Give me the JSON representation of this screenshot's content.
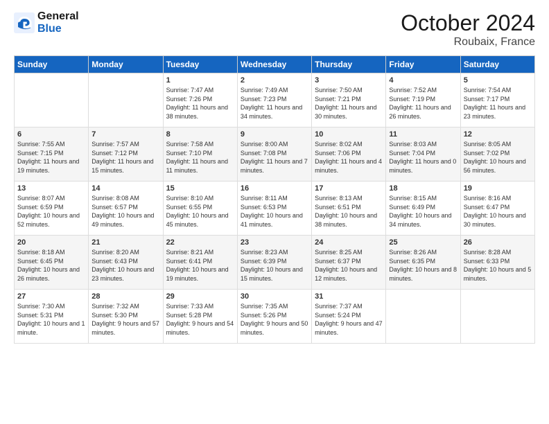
{
  "header": {
    "logo_line1": "General",
    "logo_line2": "Blue",
    "month": "October 2024",
    "location": "Roubaix, France"
  },
  "days_of_week": [
    "Sunday",
    "Monday",
    "Tuesday",
    "Wednesday",
    "Thursday",
    "Friday",
    "Saturday"
  ],
  "weeks": [
    [
      {
        "day": "",
        "info": ""
      },
      {
        "day": "",
        "info": ""
      },
      {
        "day": "1",
        "info": "Sunrise: 7:47 AM\nSunset: 7:26 PM\nDaylight: 11 hours and 38 minutes."
      },
      {
        "day": "2",
        "info": "Sunrise: 7:49 AM\nSunset: 7:23 PM\nDaylight: 11 hours and 34 minutes."
      },
      {
        "day": "3",
        "info": "Sunrise: 7:50 AM\nSunset: 7:21 PM\nDaylight: 11 hours and 30 minutes."
      },
      {
        "day": "4",
        "info": "Sunrise: 7:52 AM\nSunset: 7:19 PM\nDaylight: 11 hours and 26 minutes."
      },
      {
        "day": "5",
        "info": "Sunrise: 7:54 AM\nSunset: 7:17 PM\nDaylight: 11 hours and 23 minutes."
      }
    ],
    [
      {
        "day": "6",
        "info": "Sunrise: 7:55 AM\nSunset: 7:15 PM\nDaylight: 11 hours and 19 minutes."
      },
      {
        "day": "7",
        "info": "Sunrise: 7:57 AM\nSunset: 7:12 PM\nDaylight: 11 hours and 15 minutes."
      },
      {
        "day": "8",
        "info": "Sunrise: 7:58 AM\nSunset: 7:10 PM\nDaylight: 11 hours and 11 minutes."
      },
      {
        "day": "9",
        "info": "Sunrise: 8:00 AM\nSunset: 7:08 PM\nDaylight: 11 hours and 7 minutes."
      },
      {
        "day": "10",
        "info": "Sunrise: 8:02 AM\nSunset: 7:06 PM\nDaylight: 11 hours and 4 minutes."
      },
      {
        "day": "11",
        "info": "Sunrise: 8:03 AM\nSunset: 7:04 PM\nDaylight: 11 hours and 0 minutes."
      },
      {
        "day": "12",
        "info": "Sunrise: 8:05 AM\nSunset: 7:02 PM\nDaylight: 10 hours and 56 minutes."
      }
    ],
    [
      {
        "day": "13",
        "info": "Sunrise: 8:07 AM\nSunset: 6:59 PM\nDaylight: 10 hours and 52 minutes."
      },
      {
        "day": "14",
        "info": "Sunrise: 8:08 AM\nSunset: 6:57 PM\nDaylight: 10 hours and 49 minutes."
      },
      {
        "day": "15",
        "info": "Sunrise: 8:10 AM\nSunset: 6:55 PM\nDaylight: 10 hours and 45 minutes."
      },
      {
        "day": "16",
        "info": "Sunrise: 8:11 AM\nSunset: 6:53 PM\nDaylight: 10 hours and 41 minutes."
      },
      {
        "day": "17",
        "info": "Sunrise: 8:13 AM\nSunset: 6:51 PM\nDaylight: 10 hours and 38 minutes."
      },
      {
        "day": "18",
        "info": "Sunrise: 8:15 AM\nSunset: 6:49 PM\nDaylight: 10 hours and 34 minutes."
      },
      {
        "day": "19",
        "info": "Sunrise: 8:16 AM\nSunset: 6:47 PM\nDaylight: 10 hours and 30 minutes."
      }
    ],
    [
      {
        "day": "20",
        "info": "Sunrise: 8:18 AM\nSunset: 6:45 PM\nDaylight: 10 hours and 26 minutes."
      },
      {
        "day": "21",
        "info": "Sunrise: 8:20 AM\nSunset: 6:43 PM\nDaylight: 10 hours and 23 minutes."
      },
      {
        "day": "22",
        "info": "Sunrise: 8:21 AM\nSunset: 6:41 PM\nDaylight: 10 hours and 19 minutes."
      },
      {
        "day": "23",
        "info": "Sunrise: 8:23 AM\nSunset: 6:39 PM\nDaylight: 10 hours and 15 minutes."
      },
      {
        "day": "24",
        "info": "Sunrise: 8:25 AM\nSunset: 6:37 PM\nDaylight: 10 hours and 12 minutes."
      },
      {
        "day": "25",
        "info": "Sunrise: 8:26 AM\nSunset: 6:35 PM\nDaylight: 10 hours and 8 minutes."
      },
      {
        "day": "26",
        "info": "Sunrise: 8:28 AM\nSunset: 6:33 PM\nDaylight: 10 hours and 5 minutes."
      }
    ],
    [
      {
        "day": "27",
        "info": "Sunrise: 7:30 AM\nSunset: 5:31 PM\nDaylight: 10 hours and 1 minute."
      },
      {
        "day": "28",
        "info": "Sunrise: 7:32 AM\nSunset: 5:30 PM\nDaylight: 9 hours and 57 minutes."
      },
      {
        "day": "29",
        "info": "Sunrise: 7:33 AM\nSunset: 5:28 PM\nDaylight: 9 hours and 54 minutes."
      },
      {
        "day": "30",
        "info": "Sunrise: 7:35 AM\nSunset: 5:26 PM\nDaylight: 9 hours and 50 minutes."
      },
      {
        "day": "31",
        "info": "Sunrise: 7:37 AM\nSunset: 5:24 PM\nDaylight: 9 hours and 47 minutes."
      },
      {
        "day": "",
        "info": ""
      },
      {
        "day": "",
        "info": ""
      }
    ]
  ]
}
